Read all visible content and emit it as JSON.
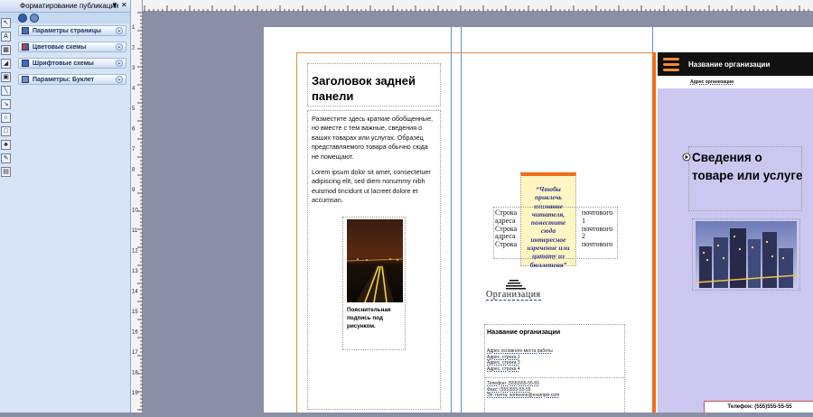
{
  "taskpane": {
    "title": "Форматирование публикации",
    "sections": [
      {
        "label": "Параметры страницы",
        "icon": "page-setup-icon",
        "color": "#4a6fb5"
      },
      {
        "label": "Цветовые схемы",
        "icon": "color-scheme-icon",
        "color": "#d3412b"
      },
      {
        "label": "Шрифтовые схемы",
        "icon": "font-scheme-icon",
        "color": "#3d6ac0"
      },
      {
        "label": "Параметры: Буклет",
        "icon": "brochure-options-icon",
        "color": "#6a8fd0"
      }
    ]
  },
  "ruler": {
    "vertical_labels": [
      "1",
      "2",
      "3",
      "4",
      "5",
      "6",
      "7",
      "8",
      "9",
      "10",
      "11",
      "12",
      "13",
      "14",
      "15",
      "16",
      "17",
      "18",
      "19"
    ]
  },
  "back_panel": {
    "heading": "Заголовок задней панели",
    "body": [
      "Разместите здесь краткие обобщенные, но вместе с тем важные, сведения о ваших товарах или услугах. Образец представляемого товара обычно сюда не помещают.",
      "Lorem ipsum dolor sit amet, consectetuer adipiscing elit, sed diem nonummy nibh euismod tincidunt ut lacreet dolore et accumsan."
    ],
    "caption": "Пояснительная подпись под рисунком."
  },
  "middle_panel": {
    "tagline": "“Чтобы привлечь внимание читателя, поместите сюда интересное изречение или цитату из бюллетеня”",
    "address_left": [
      "Строка",
      "адреса",
      "Строка",
      "адреса",
      "Строка"
    ],
    "address_right": [
      "почтового",
      "1",
      "почтового",
      "2",
      "почтового"
    ],
    "org_logo_text": "Организация",
    "org_box_title": "Название организации",
    "org_box_lines": [
      "Адрес основного места работы",
      "Адрес, строка 2",
      "Адрес, строка 3",
      "Адрес, строка 4"
    ],
    "contact_lines": [
      "Телефон: (555)555-55-55",
      "Факс: (555)555-55-55",
      "Эл. почта: someone@example.com"
    ]
  },
  "front_panel": {
    "org_name": "Название организации",
    "org_sub": "Адрес организации",
    "title": "Сведения о товаре или услуге",
    "phone": "Телефон: (555)555-55-55"
  },
  "colors": {
    "accent_orange": "#f26c1a",
    "front_lavender": "#cbc7f1",
    "guide_blue": "#5f8ed1"
  }
}
